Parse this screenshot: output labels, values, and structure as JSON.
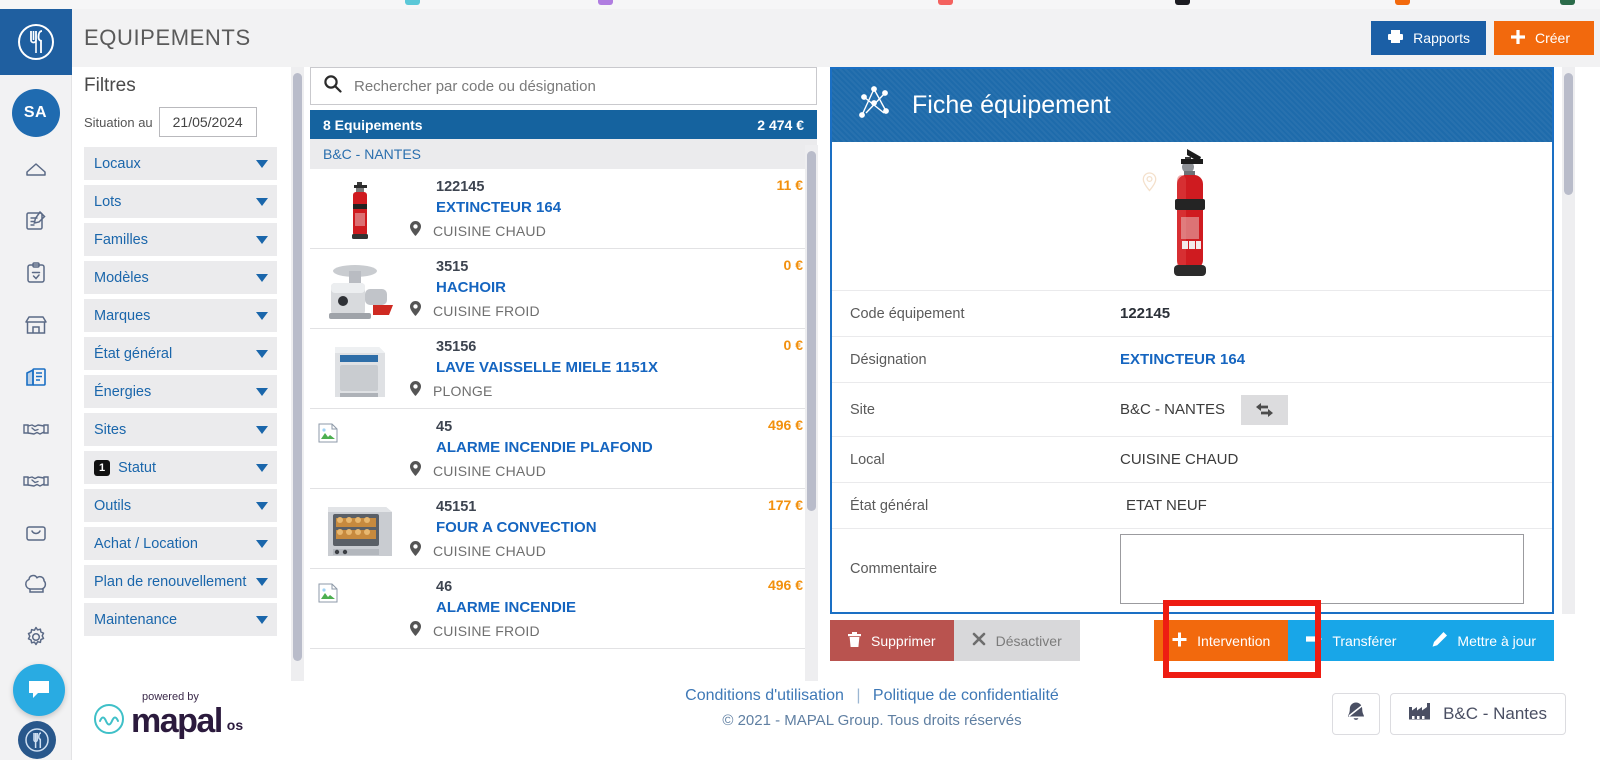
{
  "browser": {
    "bookmark_colors": [
      "#5bc8d8",
      "#b07de0",
      "#f4625f",
      "#1c1c22",
      "#f2690d",
      "#2b6b4a"
    ]
  },
  "rail": {
    "logo_icon": "cutlery-circle-logo",
    "avatar_initials": "SA",
    "items": [
      {
        "icon": "home-icon",
        "name": "sidebar-item-home",
        "active": false
      },
      {
        "icon": "edit-document-icon",
        "name": "sidebar-item-documents",
        "active": false
      },
      {
        "icon": "checklist-clipboard-icon",
        "name": "sidebar-item-checklists",
        "active": false
      },
      {
        "icon": "store-icon",
        "name": "sidebar-item-sites",
        "active": false
      },
      {
        "icon": "building-equipment-icon",
        "name": "sidebar-item-equipements",
        "active": true
      },
      {
        "icon": "handshake-icon",
        "name": "sidebar-item-suppliers",
        "active": false
      },
      {
        "icon": "handshake-icon",
        "name": "sidebar-item-contracts",
        "active": false
      },
      {
        "icon": "inbox-icon",
        "name": "sidebar-item-inbox",
        "active": false
      },
      {
        "icon": "chef-hat-icon",
        "name": "sidebar-item-recipes",
        "active": false
      },
      {
        "icon": "gear-icon",
        "name": "sidebar-item-settings",
        "active": false
      }
    ],
    "chat_icon": "chat-bubble-icon"
  },
  "header": {
    "title": "EQUIPEMENTS",
    "rapports_label": "Rapports",
    "rapports_icon": "printer-icon",
    "creer_label": "Créer",
    "creer_icon": "plus-icon",
    "rapports_color": "#1b5fa6",
    "creer_color": "#f2690d"
  },
  "filters": {
    "title": "Filtres",
    "situation_label": "Situation au",
    "situation_date": "21/05/2024",
    "items": [
      {
        "label": "Locaux",
        "badge": null
      },
      {
        "label": "Lots",
        "badge": null
      },
      {
        "label": "Familles",
        "badge": null
      },
      {
        "label": "Modèles",
        "badge": null
      },
      {
        "label": "Marques",
        "badge": null
      },
      {
        "label": "État général",
        "badge": null
      },
      {
        "label": "Énergies",
        "badge": null
      },
      {
        "label": "Sites",
        "badge": null
      },
      {
        "label": "Statut",
        "badge": "1"
      },
      {
        "label": "Outils",
        "badge": null
      },
      {
        "label": "Achat / Location",
        "badge": null
      },
      {
        "label": "Plan de renouvellement",
        "badge": null
      },
      {
        "label": "Maintenance",
        "badge": null
      }
    ]
  },
  "list": {
    "search_placeholder": "Rechercher par code ou désignation",
    "search_value": "",
    "search_icon": "search-icon",
    "summary_count": "8 Equipements",
    "summary_total": "2 474 €",
    "group_label": "B&C - NANTES",
    "rows": [
      {
        "code": "122145",
        "name": "EXTINCTEUR 164",
        "local": "CUISINE CHAUD",
        "price": "11 €",
        "thumb": "fire-extinguisher-photo"
      },
      {
        "code": "3515",
        "name": "HACHOIR",
        "local": "CUISINE FROID",
        "price": "0 €",
        "thumb": "meat-grinder-photo"
      },
      {
        "code": "35156",
        "name": "LAVE VAISSELLE MIELE 1151X",
        "local": "PLONGE",
        "price": "0 €",
        "thumb": "dishwasher-photo"
      },
      {
        "code": "45",
        "name": "ALARME INCENDIE PLAFOND",
        "local": "CUISINE CHAUD",
        "price": "496 €",
        "thumb": "broken-image"
      },
      {
        "code": "45151",
        "name": "FOUR A CONVECTION",
        "local": "CUISINE CHAUD",
        "price": "177 €",
        "thumb": "convection-oven-photo"
      },
      {
        "code": "46",
        "name": "ALARME INCENDIE",
        "local": "CUISINE FROID",
        "price": "496 €",
        "thumb": "broken-image"
      }
    ]
  },
  "detail": {
    "title": "Fiche équipement",
    "title_icon": "equipment-network-icon",
    "photo": "fire-extinguisher-photo",
    "map_pin_icon": "map-pin-icon",
    "fields": [
      {
        "label": "Code équipement",
        "value": "122145",
        "style": "bold"
      },
      {
        "label": "Désignation",
        "value": "EXTINCTEUR 164",
        "style": "link"
      },
      {
        "label": "Site",
        "value": "B&C - NANTES",
        "style": "plain",
        "swap_icon": "swap-arrows-icon"
      },
      {
        "label": "Local",
        "value": "CUISINE CHAUD",
        "style": "plain"
      },
      {
        "label": "État général",
        "value": "ETAT NEUF",
        "style": "plain"
      },
      {
        "label": "Commentaire",
        "value": "",
        "style": "textarea"
      }
    ]
  },
  "actions": {
    "supprimer_label": "Supprimer",
    "supprimer_icon": "trash-icon",
    "desactiver_label": "Désactiver",
    "desactiver_icon": "x-icon",
    "intervention_label": "Intervention",
    "intervention_icon": "plus-icon",
    "transferer_label": "Transférer",
    "transferer_icon": "arrow-right-icon",
    "mettre_a_jour_label": "Mettre à jour",
    "mettre_a_jour_icon": "pencil-icon",
    "highlight_color": "#ee1c12",
    "highlight_target": "intervention_button"
  },
  "footer": {
    "powered_by": "powered by",
    "brand": "mapal",
    "brand_suffix": "os",
    "link_terms": "Conditions d'utilisation",
    "link_separator": "|",
    "link_privacy": "Politique de confidentialité",
    "copyright": "© 2021 - MAPAL Group. Tous droits réservés",
    "bell_icon": "bell-icon",
    "site_icon": "factory-icon",
    "site_label": "B&C - Nantes"
  }
}
